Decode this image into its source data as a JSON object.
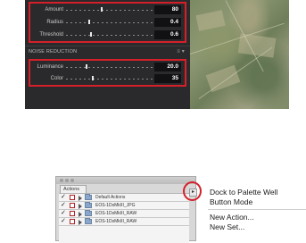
{
  "sharpen": {
    "rows": [
      {
        "label": "Amount",
        "value": "80",
        "level": 0.4
      },
      {
        "label": "Radius",
        "value": "0.4",
        "level": 0.25
      },
      {
        "label": "Threshold",
        "value": "0.6",
        "level": 0.28
      }
    ]
  },
  "noise_reduction": {
    "title": "NOISE REDUCTION",
    "rows": [
      {
        "label": "Luminance",
        "value": "20.0",
        "level": 0.22
      },
      {
        "label": "Color",
        "value": "35",
        "level": 0.3
      }
    ]
  },
  "actions_panel": {
    "tab_label": "Actions",
    "sets": [
      {
        "name": "Default Actions"
      },
      {
        "name": "EOS-1DsMkIII_JPG"
      },
      {
        "name": "EOS-1DsMkIII_RAW"
      },
      {
        "name": "EOS-1DsMkIII_RAW"
      }
    ]
  },
  "menu": {
    "items": [
      "Dock to Palette Well",
      "Button Mode",
      "New Action...",
      "New Set..."
    ]
  },
  "colors": {
    "highlight": "#d5202a",
    "dark_panel": "#2a2a2c",
    "panel_gray": "#d8d8d8"
  }
}
